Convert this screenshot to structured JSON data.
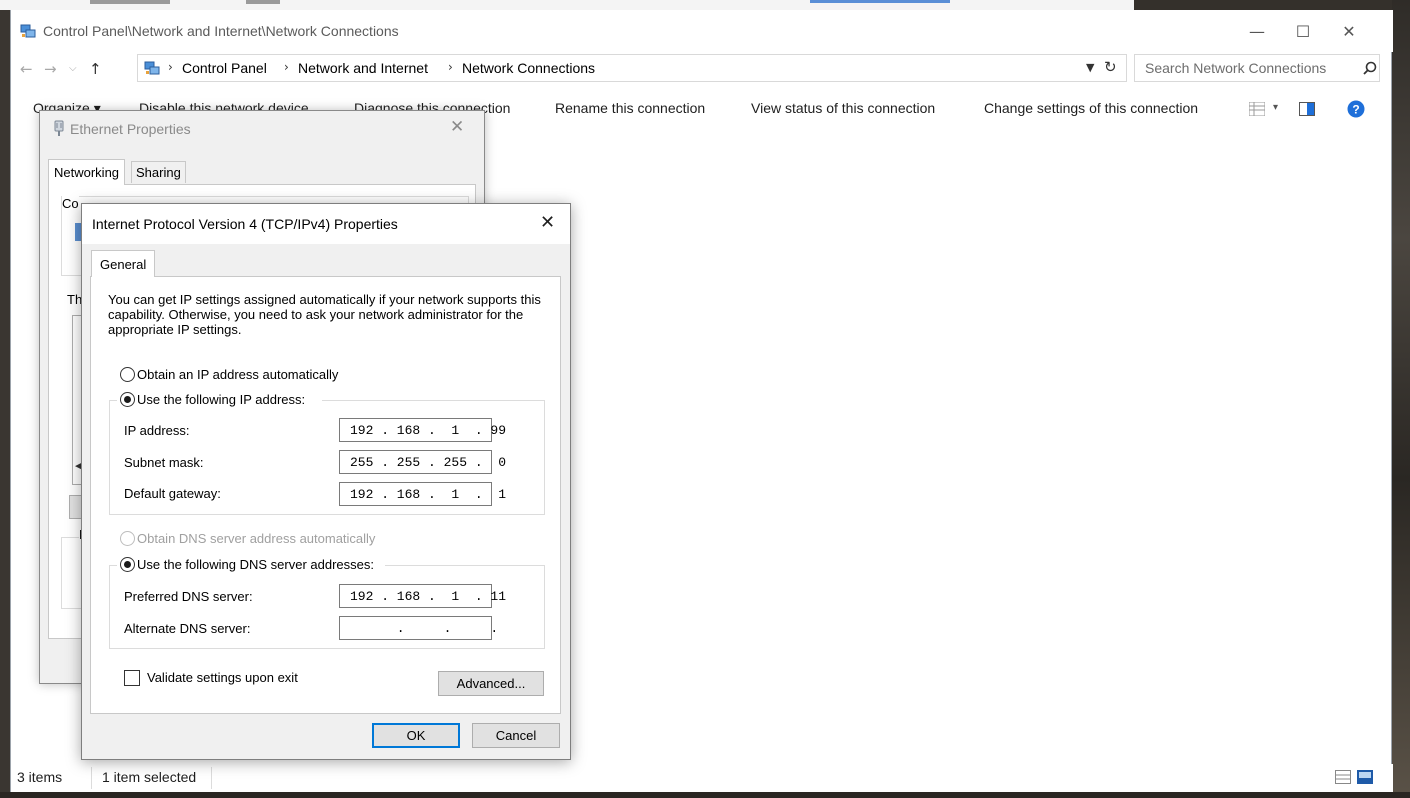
{
  "explorer": {
    "title": "Control Panel\\Network and Internet\\Network Connections",
    "window_controls": {
      "minimize": "—",
      "maximize": "☐",
      "close": "✕"
    },
    "breadcrumb": [
      "Control Panel",
      "Network and Internet",
      "Network Connections"
    ],
    "breadcrumb_separator": "›",
    "search_placeholder": "Search Network Connections",
    "commands": [
      "Organize ▾",
      "Disable this network device",
      "Diagnose this connection",
      "Rename this connection",
      "View status of this connection",
      "Change settings of this connection"
    ],
    "status": {
      "items": "3 items",
      "selected": "1 item selected"
    }
  },
  "ethernet_dialog": {
    "title": "Ethernet Properties",
    "tabs": [
      "Networking",
      "Sharing"
    ],
    "partial_labels": {
      "connect_using": "Co",
      "this_connection": "Th",
      "description": "D"
    }
  },
  "ipv4_dialog": {
    "title": "Internet Protocol Version 4 (TCP/IPv4) Properties",
    "tab": "General",
    "intro": "You can get IP settings assigned automatically if your network supports this capability. Otherwise, you need to ask your network administrator for the appropriate IP settings.",
    "ip_mode": {
      "auto_label": "Obtain an IP address automatically",
      "manual_label": "Use the following IP address:",
      "selected": "manual"
    },
    "ip_fields": [
      {
        "label": "IP address:",
        "value": "192 . 168 .  1  . 99"
      },
      {
        "label": "Subnet mask:",
        "value": "255 . 255 . 255 .  0"
      },
      {
        "label": "Default gateway:",
        "value": "192 . 168 .  1  .  1"
      }
    ],
    "dns_mode": {
      "auto_label": "Obtain DNS server address automatically",
      "manual_label": "Use the following DNS server addresses:",
      "selected": "manual",
      "auto_disabled": true
    },
    "dns_fields": [
      {
        "label": "Preferred DNS server:",
        "value": "192 . 168 .  1  . 11"
      },
      {
        "label": "Alternate DNS server:",
        "value": "      .     .     ."
      }
    ],
    "validate_label": "Validate settings upon exit",
    "validate_checked": false,
    "advanced_button": "Advanced...",
    "ok_button": "OK",
    "cancel_button": "Cancel"
  },
  "colors": {
    "accent": "#0078d7",
    "help_icon": "#1e6fd9",
    "window_bg": "#ffffff",
    "dialog_bg": "#f0f0f0"
  }
}
